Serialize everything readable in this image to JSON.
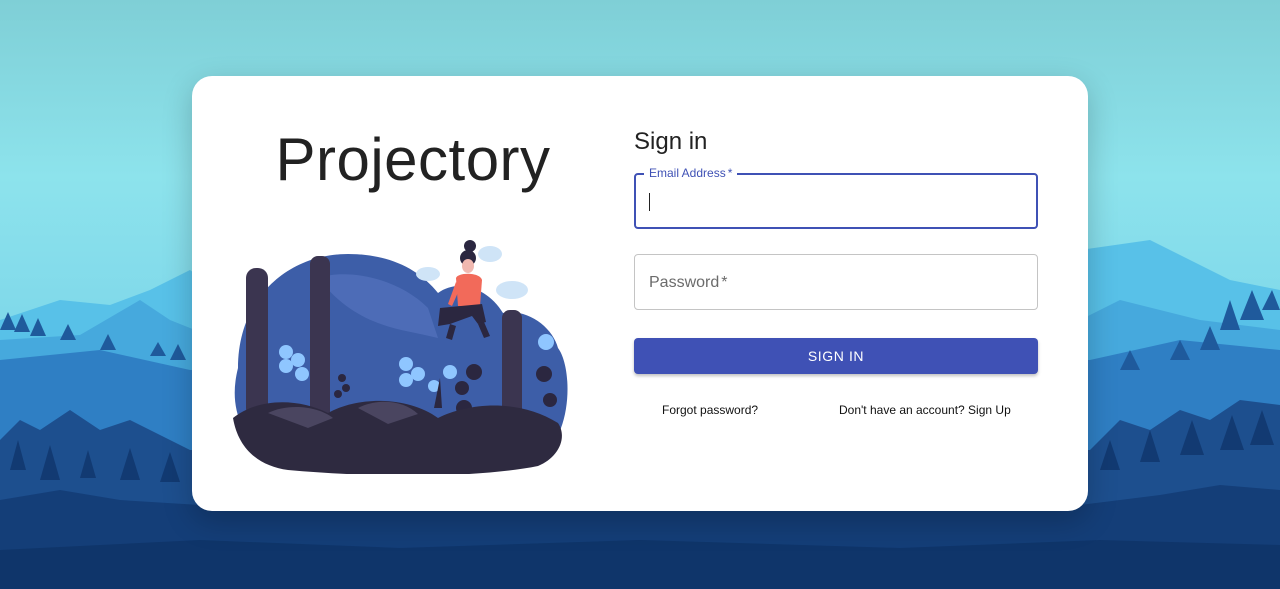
{
  "app": {
    "brand": "Projectory"
  },
  "form": {
    "title": "Sign in",
    "email": {
      "label": "Email Address",
      "required_mark": "*",
      "value": ""
    },
    "password": {
      "label": "Password",
      "required_mark": "*",
      "value": ""
    },
    "submit_label": "SIGN IN",
    "forgot_link": "Forgot password?",
    "signup_link": "Don't have an account? Sign Up"
  },
  "colors": {
    "primary": "#3f51b5",
    "card_bg": "#ffffff"
  },
  "icons": {
    "illustration": "person-sitting-on-forest-illustration",
    "background": "mountain-forest-landscape"
  }
}
